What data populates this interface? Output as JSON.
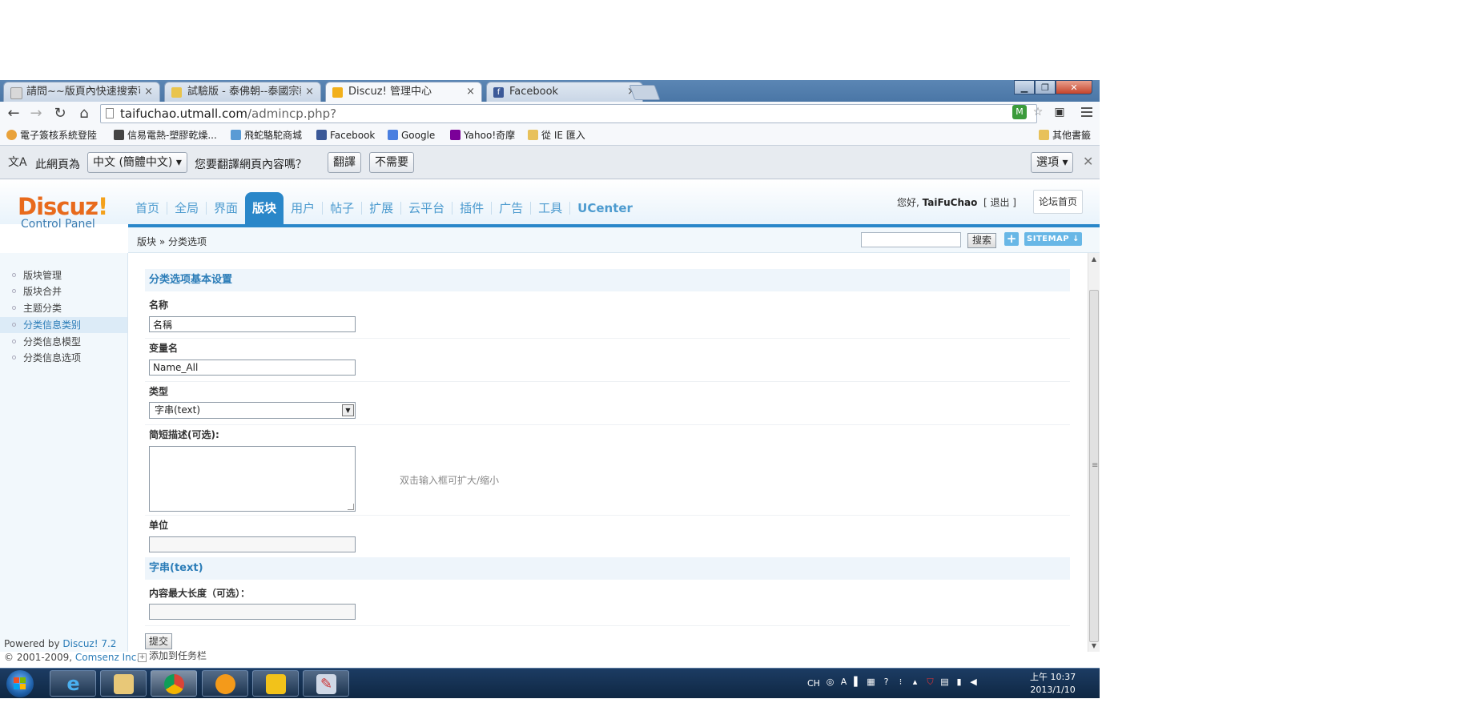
{
  "browser": {
    "tabs": [
      {
        "title": "請問~~版頁內快速搜索可...",
        "favicon_color": "#d8d8d8"
      },
      {
        "title": "試驗版 - 泰佛朝--泰國宗教...",
        "favicon_color": "#e9c44c"
      },
      {
        "title": "Discuz! 管理中心",
        "favicon_color": "#f2b01b",
        "active": true
      },
      {
        "title": "Facebook",
        "favicon_color": "#3b5998"
      }
    ],
    "close_glyph": "×",
    "url_host": "taifuchao.utmall.com",
    "url_path": "/admincp.php?",
    "bookmarks": [
      {
        "label": "電子簽核系統登陸",
        "color": "#e9a23b"
      },
      {
        "label": "信易電熱-塑膠乾燥...",
        "color": "#444"
      },
      {
        "label": "飛蛇駱駝商城",
        "color": "#5a9bd5"
      },
      {
        "label": "Facebook",
        "color": "#3b5998"
      },
      {
        "label": "Google",
        "color": "#4a7fe0"
      },
      {
        "label": "Yahoo!奇摩",
        "color": "#7b0099"
      },
      {
        "label": "從 IE 匯入",
        "color": "#e8c15a"
      }
    ],
    "other_bookmarks": "其他書籤"
  },
  "translate_bar": {
    "prefix": "此網頁為",
    "language": "中文 (簡體中文)",
    "question": "您要翻譯網頁內容嗎？",
    "translate_btn": "翻譯",
    "no_btn": "不需要",
    "options_btn": "選項"
  },
  "discuz": {
    "logo_main": "Discuz",
    "logo_bang": "!",
    "logo_sub": "Control Panel",
    "nav": [
      "首页",
      "全局",
      "界面",
      "版块",
      "用户",
      "帖子",
      "扩展",
      "云平台",
      "插件",
      "广告",
      "工具",
      "UCenter"
    ],
    "user_greeting": "您好,",
    "username": "TaiFuChao",
    "logout": "[ 退出 ]",
    "forum_home": "论坛首页",
    "breadcrumb": "版块 » 分类选项",
    "search_btn": "搜索",
    "plus": "+",
    "sitemap": "SITEMAP ↓"
  },
  "left_menu": [
    {
      "label": "版块管理"
    },
    {
      "label": "版块合并"
    },
    {
      "label": "主题分类"
    },
    {
      "label": "分类信息类别",
      "active": true
    },
    {
      "label": "分类信息模型"
    },
    {
      "label": "分类信息选项"
    }
  ],
  "footer": {
    "powered_prefix": "Powered by",
    "powered_link": "Discuz! 7.2",
    "copyright_prefix": "© 2001-2009,",
    "copyright_link": "Comsenz Inc.",
    "add_taskbar": "添加到任务栏"
  },
  "form": {
    "section1": "分类选项基本设置",
    "name_label": "名称",
    "name_value": "名稱",
    "var_label": "变量名",
    "var_value": "Name_All",
    "type_label": "类型",
    "type_value": "字串(text)",
    "desc_label": "简短描述(可选):",
    "desc_hint": "双击输入框可扩大/缩小",
    "unit_label": "单位",
    "section2": "字串(text)",
    "maxlen_label": "内容最大长度（可选）：",
    "submit": "提交"
  },
  "taskbar": {
    "tray_lang": "CH",
    "time": "上午 10:37",
    "date": "2013/1/10"
  }
}
